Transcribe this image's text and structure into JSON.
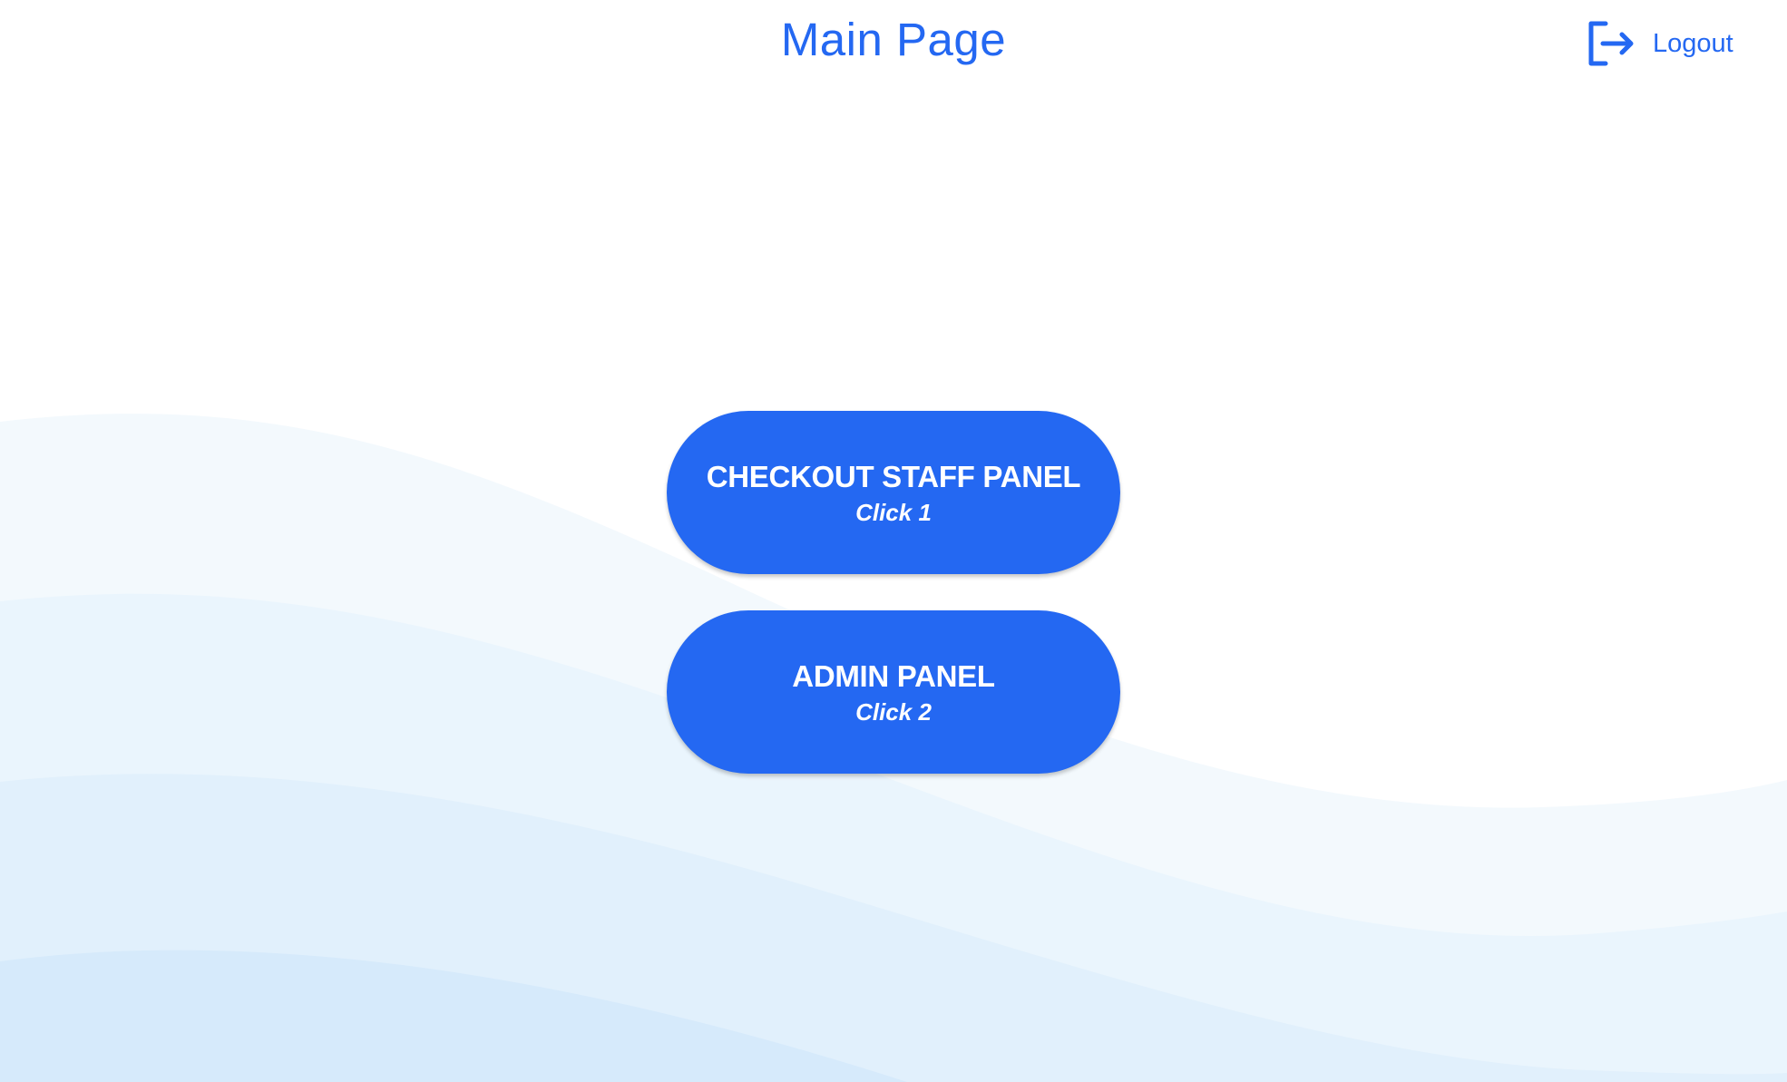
{
  "header": {
    "title": "Main Page",
    "logout_label": "Logout",
    "logout_icon": "logout-icon"
  },
  "panels": [
    {
      "title": "CHECKOUT STAFF PANEL",
      "subtitle": "Click 1"
    },
    {
      "title": "ADMIN PANEL",
      "subtitle": "Click 2"
    }
  ],
  "colors": {
    "accent": "#2468f2",
    "button_text": "#ffffff",
    "background": "#ffffff",
    "wave_1": "#f3f9fd",
    "wave_2": "#eaf5fd",
    "wave_3": "#e1f0fc",
    "wave_4": "#d6eafb"
  }
}
